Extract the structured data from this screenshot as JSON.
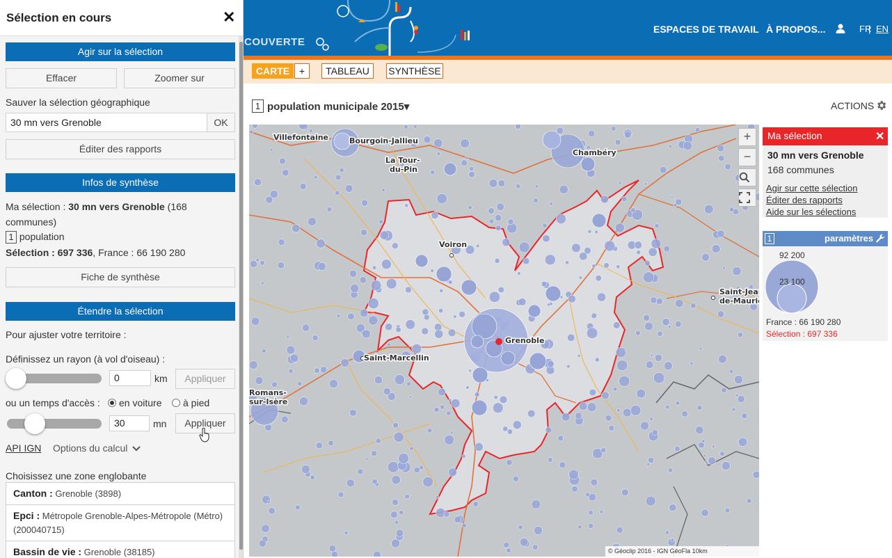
{
  "left_panel": {
    "title": "Sélection en cours",
    "act_band": "Agir sur la sélection",
    "clear_button": "Effacer",
    "zoom_button": "Zoomer sur",
    "save_label": "Sauver la sélection géographique",
    "save_input_value": "30 mn vers Grenoble",
    "ok_button": "OK",
    "edit_reports_button": "Éditer des rapports",
    "summary_band": "Infos de synthèse",
    "summary_prefix": "Ma sélection : ",
    "summary_name": "30 mn vers Grenoble",
    "summary_count": " (168",
    "summary_count_2": "communes)",
    "indicator_badge": "1",
    "indicator_name": "population",
    "selection_label": "Sélection : 697 336",
    "france_value": ", France : 66 190 280",
    "fiche_button": "Fiche de synthèse",
    "extend_band": "Étendre la sélection",
    "adjust_label": "Pour ajuster votre territoire :",
    "radius_label": "Définissez un rayon (à vol d'oiseau) :",
    "radius_value": "0",
    "radius_unit": "km",
    "apply_radius": "Appliquer",
    "access_label": "ou un temps d'accès :",
    "by_car": "en voiture",
    "by_foot": "à pied",
    "time_value": "30",
    "time_unit": "mn",
    "apply_time": "Appliquer",
    "api_link": "API IGN",
    "options_link": "Options du calcul",
    "zone_label": "Choisissez une zone englobante",
    "zones": [
      {
        "type": "Canton :",
        "value": "Grenoble (3898)"
      },
      {
        "type": "Epci :",
        "value": "Métropole Grenoble-Alpes-Métropole (Métro) (200040715)"
      },
      {
        "type": "Bassin de vie :",
        "value": "Grenoble (38185)"
      }
    ]
  },
  "header": {
    "brand_partial": "COUVERTE",
    "nav_workspaces": "ESPACES DE TRAVAIL",
    "nav_about": "À PROPOS...",
    "lang_fr": "FR",
    "lang_sep": " | ",
    "lang_en": "EN"
  },
  "tabs": {
    "map": "CARTE",
    "plus": "+",
    "table": "TABLEAU",
    "synthesis": "SYNTHÈSE"
  },
  "indicator": {
    "badge": "1",
    "label": "population municipale  2015▾",
    "actions": "ACTIONS"
  },
  "map": {
    "cities": [
      "Villefontaine",
      "Bourgoin-Jallieu",
      "La Tour-",
      "du-Pin",
      "Chambéry",
      "Voiron",
      "Saint-Jean-",
      "de-Maurie",
      "Grenoble",
      "Saint-Marcellin",
      "Romans-",
      "sur-Isère"
    ],
    "copyright": "© Géoclip 2016 - IGN GéoFla  10km"
  },
  "selection_card": {
    "header": "Ma sélection",
    "name": "30 mn vers Grenoble",
    "count": "168 communes",
    "link_act": "Agir sur cette sélection",
    "link_reports": "Éditer des rapports",
    "link_help": "Aide sur les sélections"
  },
  "legend": {
    "badge": "1",
    "title": "paramètres",
    "big_value": "92 200",
    "small_value": "23 100",
    "france": "France : 66 190 280",
    "selection": "Sélection : 697 336"
  },
  "colors": {
    "primary_blue": "#0b6eb4",
    "orange": "#f6a21c",
    "selection_red": "#e8262a",
    "bubble": "#9aa8d8"
  }
}
